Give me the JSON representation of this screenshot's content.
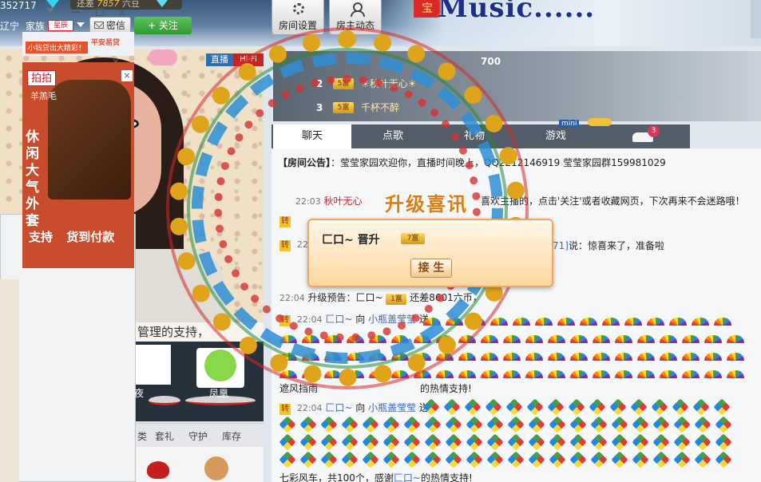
{
  "topbar": {
    "user_id": "352717",
    "diff_prefix": "还差",
    "diff_value": "7857",
    "diff_suffix": "六豆",
    "location": "辽宁",
    "family_label": "家族",
    "family_badge": "星辰",
    "message_button": "密信",
    "follow_button": "+ 关注",
    "room_settings": "房间设置",
    "host_feed": "房主动态",
    "banner_mark": "宝",
    "banner_text": "Music......"
  },
  "video": {
    "live_badge": "直播",
    "hifi_badge": "Hi-Fi",
    "close_mark": "×"
  },
  "ad": {
    "slogan": "小钱贷出大精彩！",
    "loan_brand": "平安易贷",
    "pai_badge": "拍拍",
    "collar": "羊羔毛",
    "vertical_text": "休闲大气外套",
    "footer_left": "支持",
    "footer_right": "货到付款",
    "close_mark": "×"
  },
  "under_video": {
    "mgmt_text": "管理的支持，",
    "avatar1_name": "夜",
    "avatar2_name": "凤凰",
    "gift_tabs": [
      "类",
      "套礼",
      "守护",
      "库存"
    ]
  },
  "ranking": {
    "top_score": "700",
    "rows": [
      {
        "rank": "2",
        "badge": "5富",
        "name": "☀秋叶无心☀"
      },
      {
        "rank": "3",
        "badge": "5富",
        "name": "千杯不醉"
      }
    ]
  },
  "tabs": {
    "chat": "聊天",
    "songs": "点歌",
    "gifts": "礼物",
    "games": "游戏",
    "car_count": "3",
    "mini_badge": "mini"
  },
  "chat": {
    "notice_prefix": "【房间公告】",
    "notice_text": "：莹莹家园欢迎你，直播时间晚上，QQ2212146919 莹莹家园群159981029",
    "line1_time": "22:03",
    "line1_nick": "秋叶无心",
    "line1_text": "喜欢主播的，点击'关注'或者收藏网页，下次再来不会迷路哦！",
    "line2_badge": "转",
    "line3_badge": "转",
    "line3_time": "22:0",
    "line3_link": "71]",
    "line3_text": "说：惊喜来了，准备啦",
    "line4_time": "22:04",
    "line4_prefix": "升级预告：",
    "line4_name": "匚口~",
    "line4_badge": "1富",
    "line4_text": "还差8601六币，",
    "gift1_badge": "转",
    "gift1_time": "22:04",
    "gift1_from": "匚口~",
    "gift1_to_word": "向",
    "gift1_to": "小瓶盖莹莹",
    "gift1_verb": "送",
    "umbrella_thanks": "遮风挡雨",
    "umbrella_thanks_tail": "的热情支持!",
    "gift2_badge": "转",
    "gift2_time": "22:04",
    "gift2_from": "匚口~",
    "gift2_to_word": "向",
    "gift2_to": "小瓶盖莹莹",
    "gift2_verb": "送",
    "windmill_thanks_prefix": "七彩风车，共100个，感谢",
    "windmill_thanks_name": "匚口~",
    "windmill_thanks_tail": "的热情支持!"
  },
  "levelup": {
    "title": "升级喜讯",
    "name": "匚口~ 晋升",
    "badge": "7富",
    "accept_button": "接 生"
  }
}
